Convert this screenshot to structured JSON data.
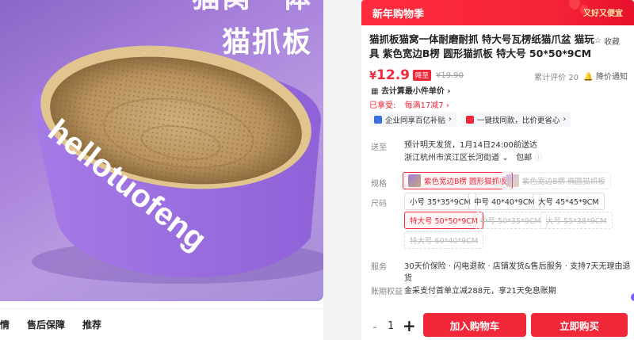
{
  "hero": {
    "title_line1": "猫窝一体",
    "title_line2": "猫抓板",
    "brand_text": "hellotuofeng",
    "colors": {
      "bg": "#a983dc",
      "band": "#9b6fe0",
      "cardboard": "#c7a472"
    }
  },
  "left_tabs": [
    "情",
    "售后保障",
    "推荐"
  ],
  "banner": {
    "title": "新年购物季",
    "tag": "又好又便宜"
  },
  "product": {
    "title": "猫抓板猫窝一体耐磨耐抓 特大号瓦楞纸猫爪盆 猫玩具 紫色宽边B楞 圆形猫抓板 特大号 50*50*9CM",
    "fav_label": "收藏",
    "price_yen": "¥",
    "price": "12.9",
    "price_badge": "降至",
    "orig_price": "¥19.90",
    "reviews": "累计评价 20",
    "price_drop": "降价通知",
    "unit_price": "去计算最小件单价",
    "sold_label": "已拿受:",
    "sold_value": "每满17减7"
  },
  "pills": [
    {
      "label": "企业同享百亿补贴",
      "icon": "enterprise-icon"
    },
    {
      "label": "一键找同款，比价更省心",
      "icon": "compare-icon"
    }
  ],
  "shipping": {
    "label": "送至",
    "line1": "预计明天发货，1月14日24:00前送达",
    "address": "浙江杭州市滨江区长河街道",
    "free": "包邮"
  },
  "spec": {
    "label": "规格",
    "options": [
      {
        "text": "紫色宽边B楞 圆形猫抓板",
        "state": "selected"
      },
      {
        "text": "紫色宽边B楞 椭圆猫抓板",
        "state": "disabled"
      }
    ]
  },
  "size": {
    "label": "尺码",
    "options": [
      {
        "text": "小号 35*35*9CM",
        "state": "normal"
      },
      {
        "text": "中号 40*40*9CM",
        "state": "normal"
      },
      {
        "text": "大号 45*45*9CM",
        "state": "normal"
      },
      {
        "text": "特大号 50*50*9CM",
        "state": "selected"
      },
      {
        "text": "中号 50*35*9CM",
        "state": "disabled"
      },
      {
        "text": "大号 55*38*9CM",
        "state": "disabled"
      },
      {
        "text": "特大号 60*40*9CM",
        "state": "disabled"
      }
    ]
  },
  "service": {
    "label": "服务",
    "text": "30天价保险 · 闪电退款 · 店铺发货&售后服务 · 支持7天无理由退货"
  },
  "credit": {
    "label": "账期权益",
    "text": "金采支付首单立减288元，享21天免息账期"
  },
  "bottom": {
    "qty_minus": "-",
    "qty": "1",
    "qty_plus": "+",
    "cart": "加入购物车",
    "buy": "立即购买"
  },
  "accent": "#f0283a"
}
